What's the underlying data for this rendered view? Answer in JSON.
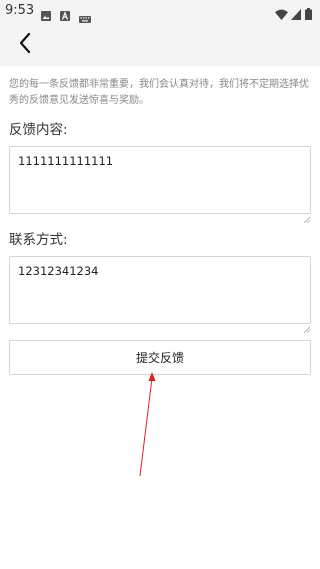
{
  "status_bar": {
    "time": "9:53",
    "icons": [
      "image-icon",
      "font-download-icon",
      "keyboard-icon",
      "wifi-icon",
      "signal-icon",
      "battery-icon"
    ]
  },
  "app_bar": {
    "back_icon": "chevron-left-icon"
  },
  "intro": {
    "text": "您的每一条反馈都非常重要，我们会认真对待，我们将不定期选择优秀的反馈意见发送惊喜与奖励。"
  },
  "feedback": {
    "label": "反馈内容:",
    "value": "1111111111111"
  },
  "contact": {
    "label": "联系方式:",
    "value": "12312341234"
  },
  "submit": {
    "label": "提交反馈"
  },
  "colors": {
    "bar_background": "#f4f4f4",
    "border": "#d6d6d6",
    "hint_text": "#888888",
    "annotation_arrow": "#e02020"
  }
}
